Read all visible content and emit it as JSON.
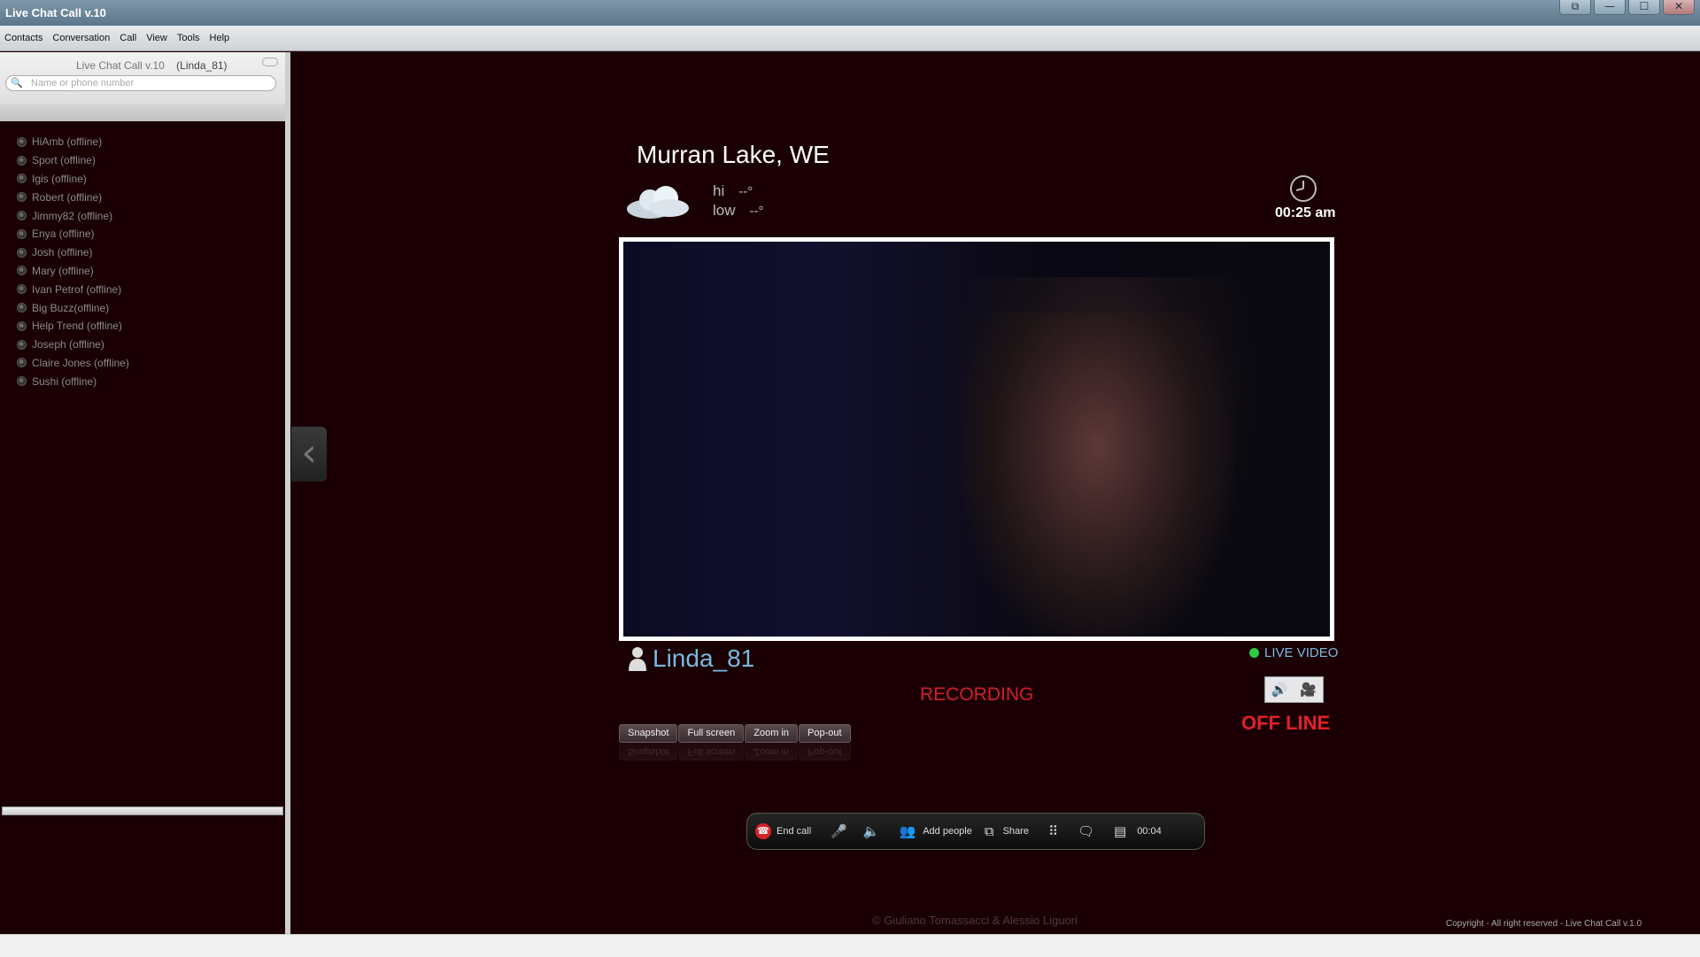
{
  "window": {
    "title": "Live Chat Call v.10",
    "controls": {
      "restore": "⧉",
      "minimize": "—",
      "maximize": "☐",
      "close": "✕"
    }
  },
  "menu": [
    "Contacts",
    "Conversation",
    "Call",
    "View",
    "Tools",
    "Help"
  ],
  "sidebar": {
    "app_label": "Live Chat Call v.10",
    "user_label": "(Linda_81)",
    "search_placeholder": "Name or phone number",
    "search_value": "",
    "contacts": [
      "HiAmb (offline)",
      "Sport (offline)",
      "Igis (offline)",
      "Robert (offline)",
      "Jimmy82 (offline)",
      "Enya (offline)",
      "Josh (offline)",
      "Mary (offline)",
      "Ivan Petrof (offline)",
      "Big Buzz(offline)",
      "Help Trend (offline)",
      "Joseph (offline)",
      "Claire Jones (offline)",
      "Sushi (offline)"
    ]
  },
  "weather": {
    "location": "Murran Lake, WE",
    "hi_label": "hi",
    "hi_value": "--°",
    "low_label": "low",
    "low_value": "--°",
    "time": "00:25 am"
  },
  "call": {
    "caller": "Linda_81",
    "live_label": "LIVE VIDEO",
    "recording_label": "RECORDING",
    "offline_label": "OFF LINE",
    "video_tools": [
      "Snapshot",
      "Full screen",
      "Zoom in",
      "Pop-out"
    ],
    "toolbar": {
      "end_call": "End call",
      "add_people": "Add people",
      "share": "Share",
      "timer": "00:04"
    }
  },
  "footer": {
    "credit": "© Giuliano Tomassacci & Alessio Liguori",
    "copyright": "Copyright  - All right reserved - Live Chat Call v.1.0"
  },
  "colors": {
    "background": "#1a0004",
    "accent_blue": "#7ab8e0",
    "recording_red": "#d0202a",
    "live_green": "#2ecc40"
  }
}
